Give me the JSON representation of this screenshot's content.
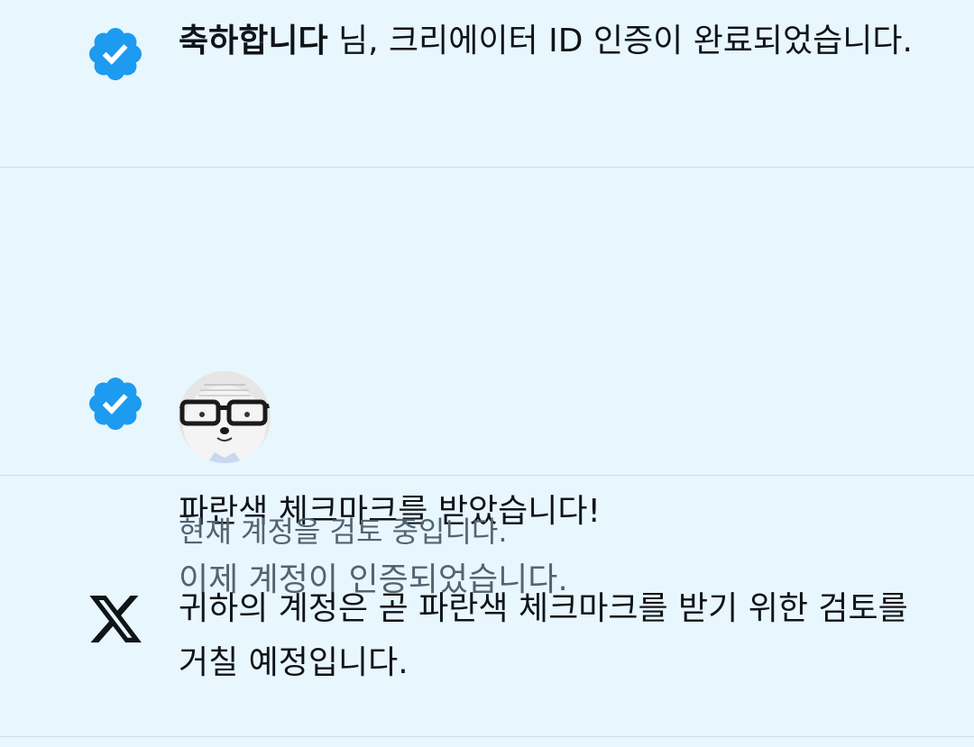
{
  "notifications": [
    {
      "icon": "verified-badge-icon",
      "bold_text": "축하합니다",
      "text": " 님, 크리에이터 ID 인증이 완료되었습니다."
    },
    {
      "icon": "verified-badge-icon",
      "avatar": "avatar",
      "title": "파란색 체크마크를 받았습니다!",
      "subtitle": "이제 계정이 인증되었습니다."
    },
    {
      "icon": "x-logo-icon",
      "status": "현재 계정을 검토 중입니다.",
      "text": "귀하의 계정은 곧 파란색 체크마크를 받기 위한 검토를 거칠 예정입니다."
    }
  ],
  "colors": {
    "background": "#e8f6fd",
    "verified_blue": "#1d9bf0",
    "text_primary": "#0f1419",
    "text_secondary": "#536471",
    "divider": "#cfdfe7"
  }
}
